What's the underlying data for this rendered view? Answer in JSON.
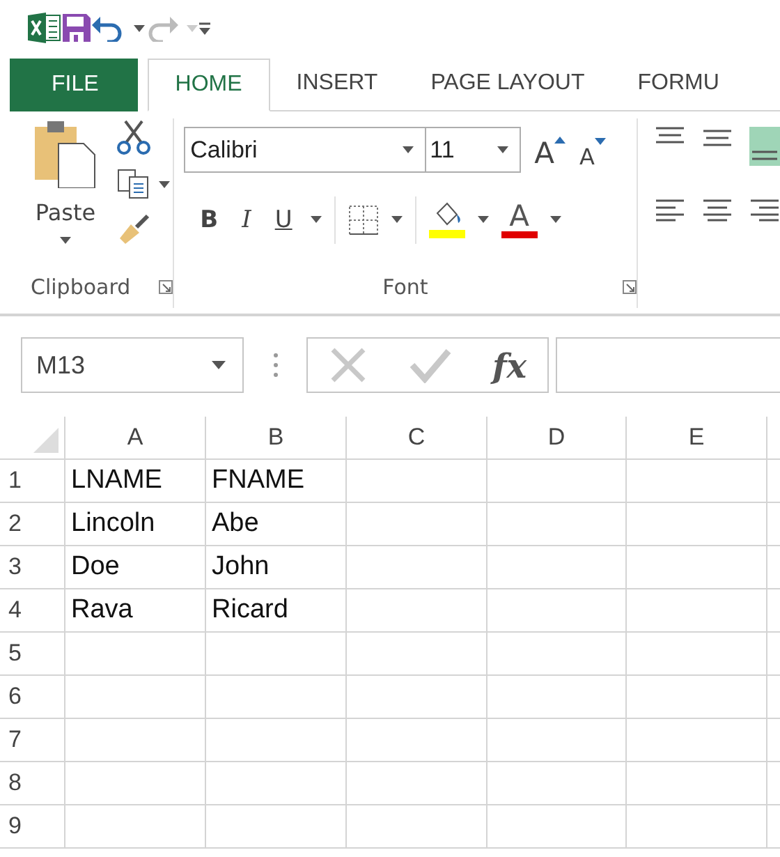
{
  "tabs": [
    {
      "label": "FILE",
      "kind": "backstage",
      "selected": false
    },
    {
      "label": "HOME",
      "kind": "tab",
      "selected": true
    },
    {
      "label": "INSERT",
      "kind": "tab",
      "selected": false
    },
    {
      "label": "PAGE LAYOUT",
      "kind": "tab",
      "selected": false
    },
    {
      "label": "FORMU",
      "kind": "tab",
      "selected": false
    }
  ],
  "ribbon": {
    "clipboard": {
      "label": "Clipboard",
      "paste_label": "Paste"
    },
    "font": {
      "label": "Font",
      "font_name": "Calibri",
      "font_size": "11",
      "grow_label": "A",
      "shrink_label": "A",
      "style_buttons": [
        {
          "label": "B",
          "kind": "bold"
        },
        {
          "label": "I",
          "kind": "italic"
        },
        {
          "label": "U",
          "kind": "underline"
        }
      ],
      "font_color_label": "A"
    }
  },
  "formula_bar": {
    "name_box": "M13",
    "function_label": "fx"
  },
  "sheet": {
    "columns": [
      "A",
      "B",
      "C",
      "D",
      "E"
    ],
    "rows": [
      {
        "header": "1",
        "cells": [
          "LNAME",
          "FNAME",
          "",
          "",
          ""
        ]
      },
      {
        "header": "2",
        "cells": [
          "Lincoln",
          "Abe",
          "",
          "",
          ""
        ]
      },
      {
        "header": "3",
        "cells": [
          "Doe",
          "John",
          "",
          "",
          ""
        ]
      },
      {
        "header": "4",
        "cells": [
          "Rava",
          "Ricard",
          "",
          "",
          ""
        ]
      },
      {
        "header": "5",
        "cells": [
          "",
          "",
          "",
          "",
          ""
        ]
      },
      {
        "header": "6",
        "cells": [
          "",
          "",
          "",
          "",
          ""
        ]
      },
      {
        "header": "7",
        "cells": [
          "",
          "",
          "",
          "",
          ""
        ]
      },
      {
        "header": "8",
        "cells": [
          "",
          "",
          "",
          "",
          ""
        ]
      },
      {
        "header": "9",
        "cells": [
          "",
          "",
          "",
          "",
          ""
        ]
      }
    ]
  }
}
